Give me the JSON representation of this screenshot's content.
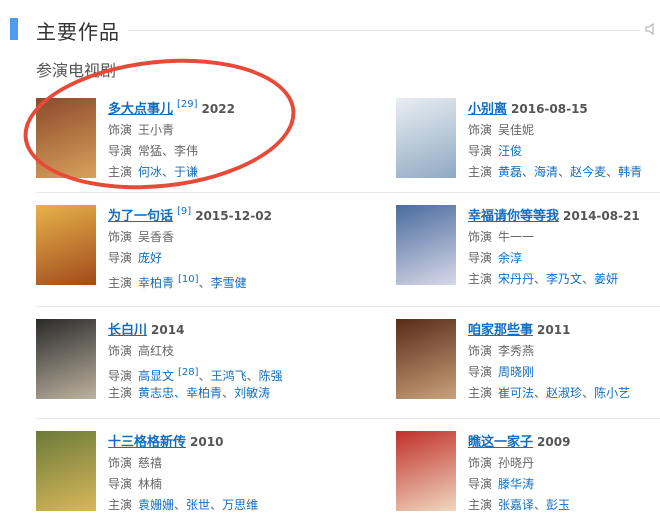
{
  "section": {
    "title": "主要作品",
    "icon": "speaker-icon"
  },
  "subsection": {
    "title": "参演电视剧"
  },
  "labels": {
    "role": "饰演",
    "director": "导演",
    "cast": "主演"
  },
  "works": [
    {
      "title": "多大点事儿",
      "ref": "[29]",
      "date": "2022",
      "role": "王小青",
      "directors": [
        "常猛",
        "李伟"
      ],
      "cast": [
        "何冰",
        "于谦"
      ],
      "cast_ref": "",
      "poster_colors": [
        "#8b4a2b",
        "#d9a15c"
      ]
    },
    {
      "title": "小别离",
      "ref": "",
      "date": "2016-08-15",
      "role": "吴佳妮",
      "directors": [
        "汪俊"
      ],
      "cast": [
        "黄磊",
        "海清",
        "赵今麦",
        "韩青"
      ],
      "cast_ref": "",
      "poster_colors": [
        "#e9eef2",
        "#8fa9c2"
      ]
    },
    {
      "title": "为了一句话",
      "ref": "[9]",
      "date": "2015-12-02",
      "role": "吴香香",
      "directors": [
        "庞好"
      ],
      "cast": [
        "幸柏青",
        "李雪健"
      ],
      "cast_ref": "[10]",
      "poster_colors": [
        "#e8b24a",
        "#a04a1c"
      ]
    },
    {
      "title": "幸福请你等等我",
      "ref": "",
      "date": "2014-08-21",
      "role": "牛一一",
      "directors": [
        "余淳"
      ],
      "cast": [
        "宋丹丹",
        "李乃文",
        "姜妍"
      ],
      "cast_ref": "",
      "poster_colors": [
        "#4a6c9e",
        "#d8d8e8"
      ]
    },
    {
      "title": "长白川",
      "ref": "",
      "date": "2014",
      "role": "高红枝",
      "directors": [
        "高显文",
        "王鸿飞",
        "陈强"
      ],
      "director_ref": "[28]",
      "cast": [
        "黄志忠",
        "幸柏青",
        "刘敏涛"
      ],
      "cast_ref": "",
      "poster_colors": [
        "#2a2a2a",
        "#bdb3a0"
      ]
    },
    {
      "title": "咱家那些事",
      "ref": "",
      "date": "2011",
      "role": "李秀燕",
      "directors": [
        "周晓刚"
      ],
      "cast": [
        "崔可法",
        "赵淑珍",
        "陈小艺"
      ],
      "cast_ref": "",
      "poster_colors": [
        "#5a2a1a",
        "#c9a27a"
      ]
    },
    {
      "title": "十三格格新传",
      "ref": "",
      "date": "2010",
      "role": "慈禧",
      "directors": [
        "林楠"
      ],
      "cast": [
        "袁姗姗",
        "张世",
        "万思维"
      ],
      "cast_ref": "",
      "poster_colors": [
        "#6b7a3a",
        "#d9b85a"
      ]
    },
    {
      "title": "瞧这一家子",
      "ref": "",
      "date": "2009",
      "role": "孙晓丹",
      "directors": [
        "滕华涛"
      ],
      "cast": [
        "张嘉译",
        "彭玉"
      ],
      "cast_ref": "",
      "poster_colors": [
        "#c0302a",
        "#f0d8c0"
      ]
    }
  ]
}
